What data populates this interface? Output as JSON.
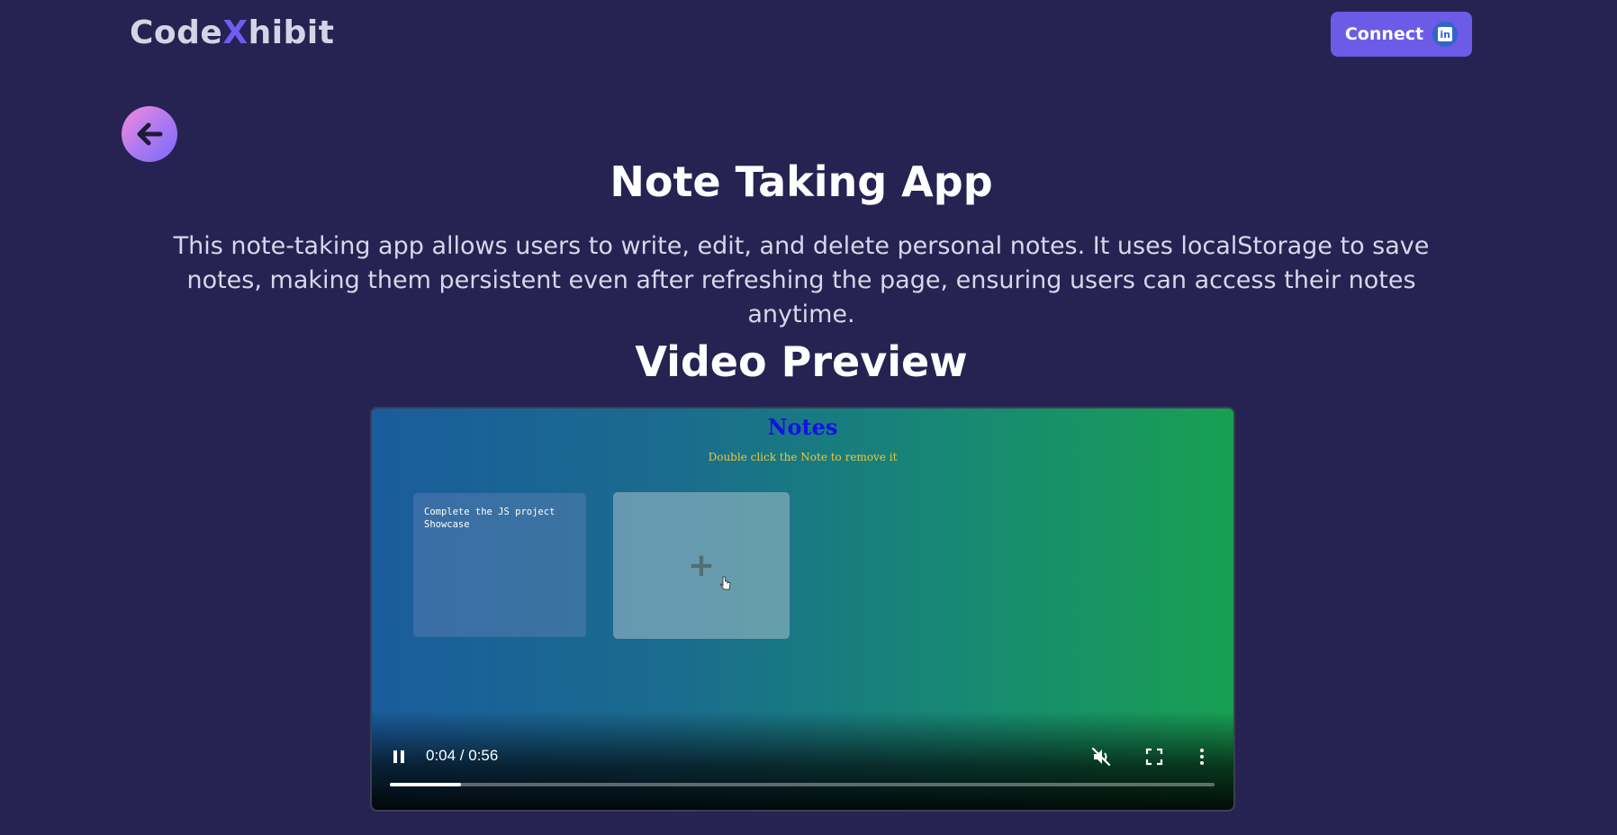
{
  "header": {
    "logo_part1": "Code",
    "logo_part2": "X",
    "logo_part3": "hibit",
    "connect_label": "Connect",
    "linkedin_glyph": "in"
  },
  "back_button": {
    "icon": "arrow-left-icon"
  },
  "main": {
    "title": "Note Taking App",
    "description": "This note-taking app allows users to write, edit, and delete personal notes. It uses localStorage to save notes, making them persistent even after refreshing the page, ensuring users can access their notes anytime.",
    "video_section_title": "Video Preview"
  },
  "video": {
    "frame": {
      "heading": "Notes",
      "hint": "Double click the Note to remove it",
      "note_text": "Complete the JS project\nShowcase",
      "add_glyph": "+"
    },
    "player": {
      "time": "0:04 / 0:56",
      "progress_fraction": 0.086,
      "icons": [
        "pause-icon",
        "mute-icon",
        "fullscreen-icon",
        "more-options-icon"
      ]
    }
  },
  "colors": {
    "background": "#262352",
    "accent": "#6b5be6",
    "logo_x": "#6f5cf2"
  }
}
